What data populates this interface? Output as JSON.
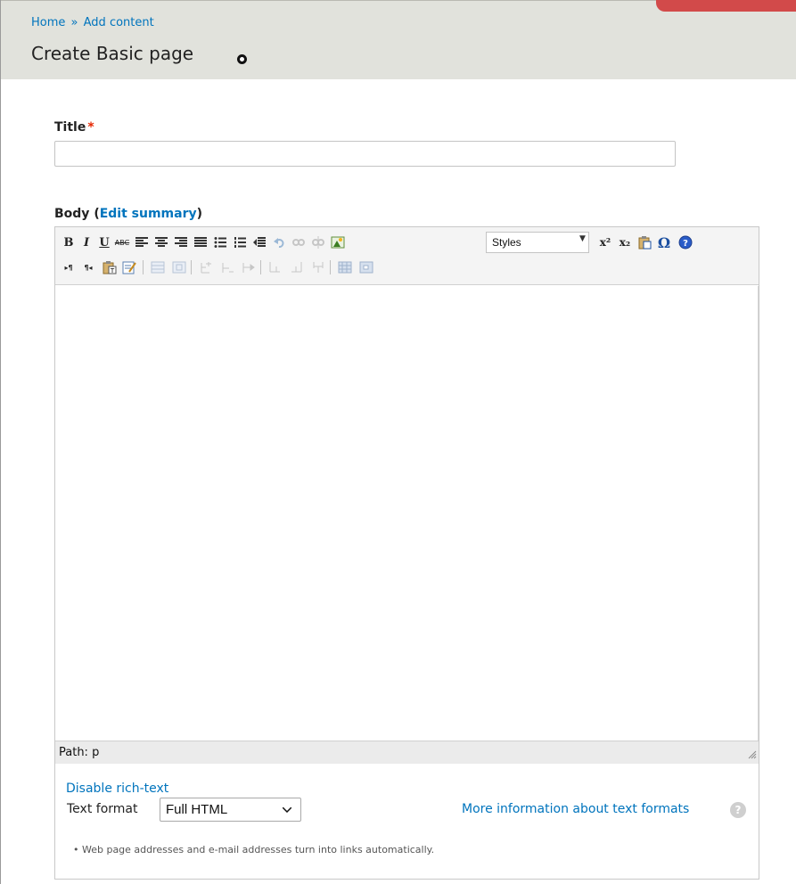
{
  "breadcrumb": {
    "home": "Home",
    "separator": "»",
    "current": "Add content"
  },
  "page": {
    "title": "Create Basic page"
  },
  "title_field": {
    "label": "Title",
    "required_marker": "*",
    "value": ""
  },
  "body_field": {
    "label": "Body",
    "open_paren": "(",
    "link": "Edit summary",
    "close_paren": ")"
  },
  "toolbar": {
    "bold": "B",
    "italic": "I",
    "underline": "U",
    "strike": "ABC",
    "superscript": "x²",
    "subscript": "x₂",
    "special_char": "Ω",
    "ltr": "▸¶",
    "rtl": "¶◂",
    "styles_label": "Styles"
  },
  "editor": {
    "path_label": "Path: p"
  },
  "format": {
    "disable_link": "Disable rich-text",
    "label": "Text format",
    "selected": "Full HTML",
    "more_info": "More information about text formats",
    "help_glyph": "?",
    "tip": "• Web page addresses and e-mail addresses turn into links automatically."
  },
  "colors": {
    "link": "#0074bd",
    "header_bg": "#e1e2dc",
    "required": "#e62600",
    "admin_tab": "#d24a4a"
  }
}
